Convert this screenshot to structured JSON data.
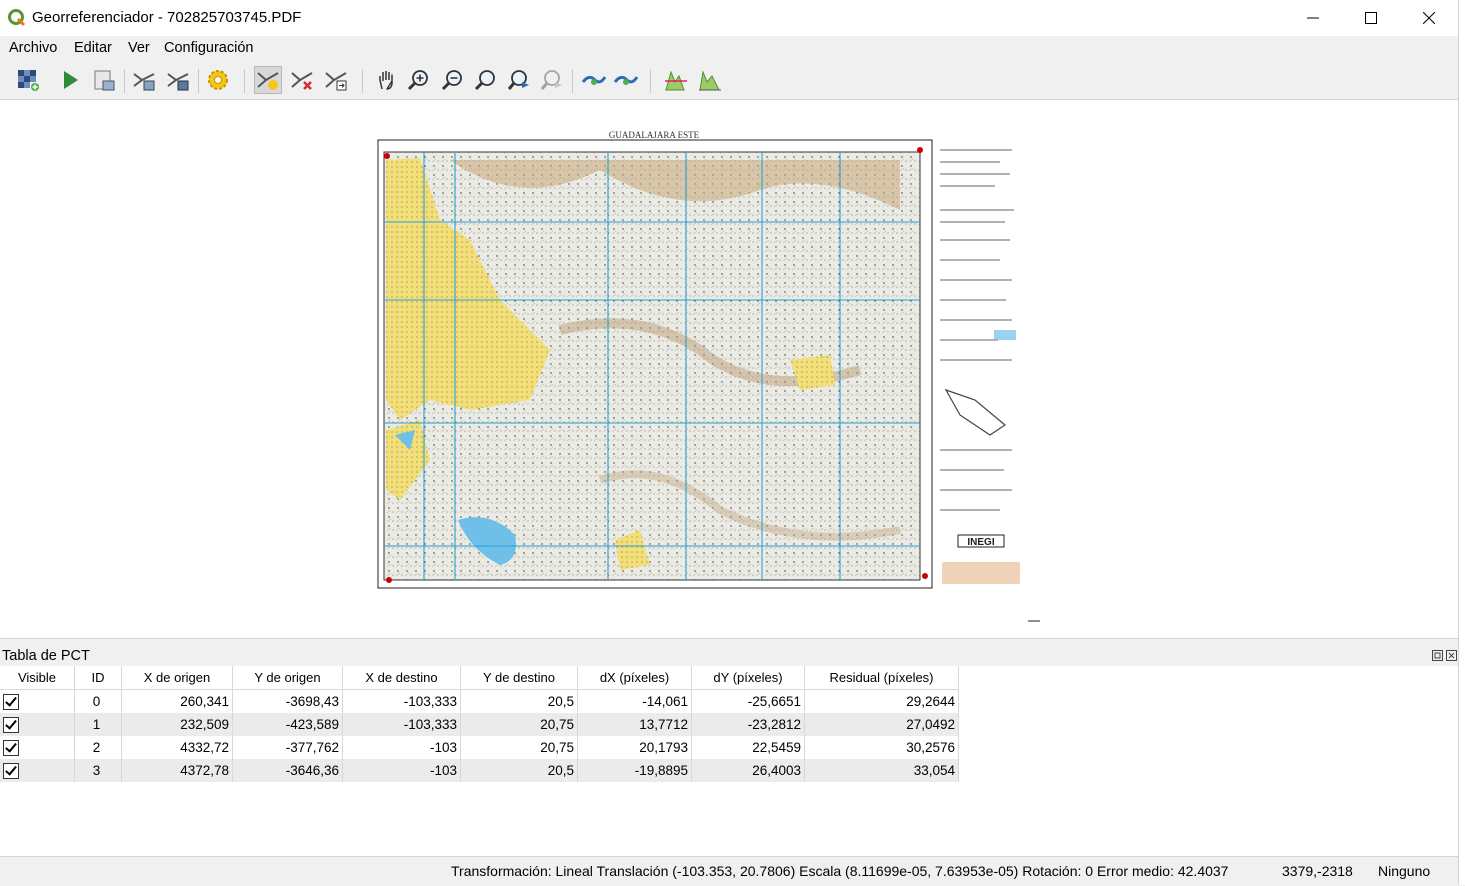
{
  "window": {
    "title": "Georreferenciador - 702825703745.PDF"
  },
  "menu": {
    "items": [
      "Archivo",
      "Editar",
      "Ver",
      "Configuración"
    ]
  },
  "toolbar": {
    "icons": [
      "open-raster-icon",
      "start-georeferencing-icon",
      "generate-gdal-script-icon",
      "load-gcp-points-icon",
      "save-gcp-points-icon",
      "transformation-settings-icon",
      "add-point-icon",
      "delete-point-icon",
      "move-gcp-point-icon",
      "pan-icon",
      "zoom-in-icon",
      "zoom-out-icon",
      "zoom-to-layer-icon",
      "zoom-last-icon",
      "zoom-next-icon",
      "link-georeferencer-to-qgis-icon",
      "link-qgis-to-georeferencer-icon",
      "full-histogram-stretch-icon",
      "local-histogram-stretch-icon"
    ]
  },
  "map": {
    "sheet_title": "GUADALAJARA ESTE",
    "publisher": "INEGI",
    "colors": {
      "grid": "#2a9fd6",
      "urban": "#f2df7a",
      "terrain": "#c8a878",
      "water": "#6fc0e8",
      "gcp": "#cc0000"
    }
  },
  "panel": {
    "title": "Tabla de PCT"
  },
  "table": {
    "columns": [
      "Visible",
      "ID",
      "X de origen",
      "Y de origen",
      "X de destino",
      "Y de destino",
      "dX (píxeles)",
      "dY (píxeles)",
      "Residual (píxeles)"
    ],
    "rows": [
      {
        "visible": true,
        "id": "0",
        "x_origen": "260,341",
        "y_origen": "-3698,43",
        "x_destino": "-103,333",
        "y_destino": "20,5",
        "dx": "-14,061",
        "dy": "-25,6651",
        "residual": "29,2644"
      },
      {
        "visible": true,
        "id": "1",
        "x_origen": "232,509",
        "y_origen": "-423,589",
        "x_destino": "-103,333",
        "y_destino": "20,75",
        "dx": "13,7712",
        "dy": "-23,2812",
        "residual": "27,0492"
      },
      {
        "visible": true,
        "id": "2",
        "x_origen": "4332,72",
        "y_origen": "-377,762",
        "x_destino": "-103",
        "y_destino": "20,75",
        "dx": "20,1793",
        "dy": "22,5459",
        "residual": "30,2576"
      },
      {
        "visible": true,
        "id": "3",
        "x_origen": "4372,78",
        "y_origen": "-3646,36",
        "x_destino": "-103",
        "y_destino": "20,5",
        "dx": "-19,8895",
        "dy": "26,4003",
        "residual": "33,054"
      }
    ]
  },
  "status": {
    "transform": "Transformación: Lineal Translación (-103.353, 20.7806) Escala (8.11699e-05, 7.63953e-05) Rotación: 0 Error medio: 42.4037",
    "coords": "3379,-2318",
    "crs": "Ninguno"
  }
}
